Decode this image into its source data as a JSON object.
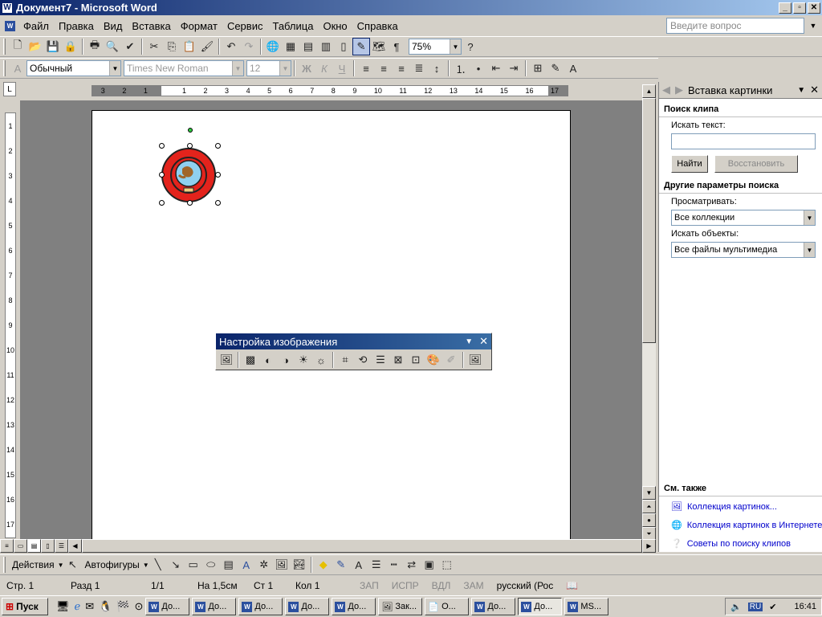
{
  "window": {
    "title": "Документ7 - Microsoft Word",
    "app_icon": "W"
  },
  "menu": [
    "Файл",
    "Правка",
    "Вид",
    "Вставка",
    "Формат",
    "Сервис",
    "Таблица",
    "Окно",
    "Справка"
  ],
  "ask_placeholder": "Введите вопрос",
  "toolbar": {
    "zoom": "75%"
  },
  "format": {
    "style": "Обычный",
    "font": "Times New Roman",
    "size": "12",
    "bold": "Ж",
    "italic": "К",
    "underline": "Ч"
  },
  "ruler": {
    "marks": [
      "3",
      "2",
      "1",
      "",
      "1",
      "2",
      "3",
      "4",
      "5",
      "6",
      "7",
      "8",
      "9",
      "10",
      "11",
      "12",
      "13",
      "14",
      "15",
      "16",
      "17"
    ]
  },
  "vruler": [
    "1",
    "2",
    "3",
    "4",
    "5",
    "6",
    "7",
    "8",
    "9",
    "10",
    "11",
    "12",
    "13",
    "14",
    "15",
    "16",
    "17"
  ],
  "panel": {
    "title": "Вставка картинки",
    "search_heading": "Поиск клипа",
    "search_label": "Искать текст:",
    "find_btn": "Найти",
    "restore_btn": "Восстановить",
    "other_heading": "Другие параметры поиска",
    "browse_label": "Просматривать:",
    "browse_value": "Все коллекции",
    "objects_label": "Искать объекты:",
    "objects_value": "Все файлы мультимедиа",
    "see_also": "См. также",
    "links": [
      "Коллекция картинок...",
      "Коллекция картинок в Интернете",
      "Советы по поиску клипов"
    ]
  },
  "picture_toolbar": {
    "title": "Настройка изображения"
  },
  "drawing": {
    "actions": "Действия",
    "autoshapes": "Автофигуры"
  },
  "status": [
    "Стр. 1",
    "Разд 1",
    "1/1",
    "На 1,5см",
    "Ст 1",
    "Кол 1",
    "ЗАП",
    "ИСПР",
    "ВДЛ",
    "ЗАМ",
    "русский (Рос"
  ],
  "taskbar": {
    "start": "Пуск",
    "buttons": [
      "До...",
      "До...",
      "До...",
      "До...",
      "До...",
      "Зак...",
      "О...",
      "До...",
      "До...",
      "MS..."
    ],
    "lang": "RU",
    "clock": "16:41"
  }
}
